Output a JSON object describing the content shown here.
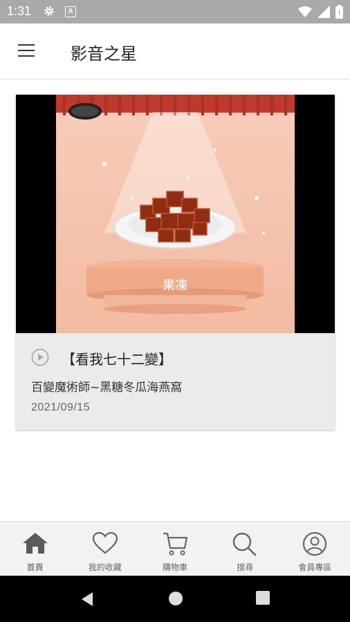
{
  "status_bar": {
    "time": "1:31",
    "badge_letter": "A"
  },
  "app_bar": {
    "title": "影音之星"
  },
  "card": {
    "title": "【看我七十二變】",
    "subtitle": "百變魔術師~黑糖冬瓜海燕窩",
    "date": "2021/09/15",
    "video_overlay_text": "果凍"
  },
  "bottom_nav": {
    "items": [
      {
        "label": "首頁",
        "icon": "home-icon"
      },
      {
        "label": "我的收藏",
        "icon": "heart-icon"
      },
      {
        "label": "購物車",
        "icon": "cart-icon"
      },
      {
        "label": "搜尋",
        "icon": "search-icon"
      },
      {
        "label": "會員專區",
        "icon": "user-icon"
      }
    ],
    "active_index": 0
  },
  "colors": {
    "nav_active": "#555555",
    "nav_inactive": "#777777",
    "status_bar": "#a9a9a9"
  }
}
